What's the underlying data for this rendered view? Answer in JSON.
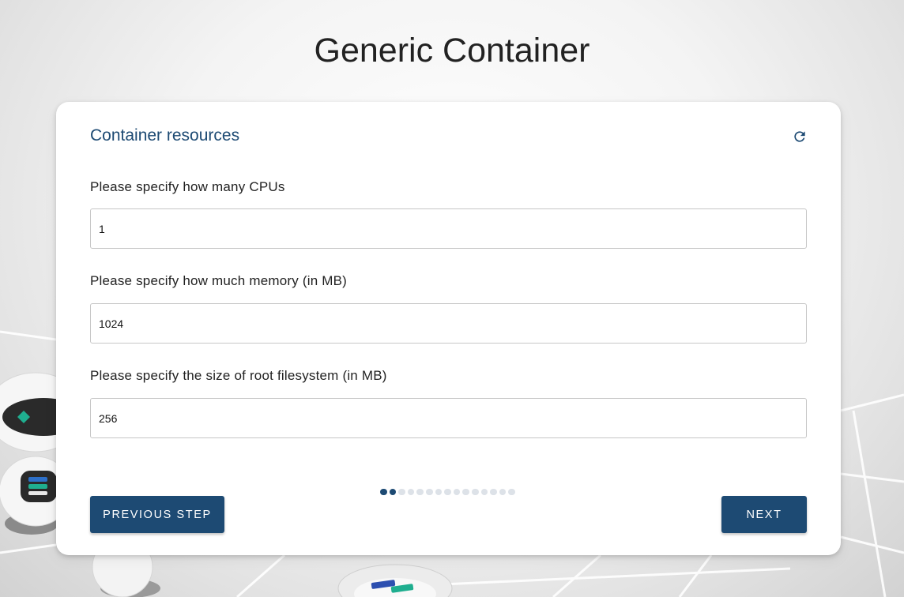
{
  "page": {
    "title": "Generic Container"
  },
  "card": {
    "title": "Container resources",
    "refresh_icon": "refresh-icon"
  },
  "fields": [
    {
      "label": "Please specify how many CPUs",
      "value": "1"
    },
    {
      "label": "Please specify how much memory (in MB)",
      "value": "1024"
    },
    {
      "label": "Please specify the size of root filesystem (in MB)",
      "value": "256"
    }
  ],
  "progress": {
    "total_steps": 15,
    "active_steps": 2
  },
  "buttons": {
    "previous_label": "PREVIOUS STEP",
    "next_label": "NEXT"
  },
  "colors": {
    "accent": "#1d4a73",
    "inactive_dot": "#dde2e8",
    "robot_teal": "#1fae8f"
  }
}
